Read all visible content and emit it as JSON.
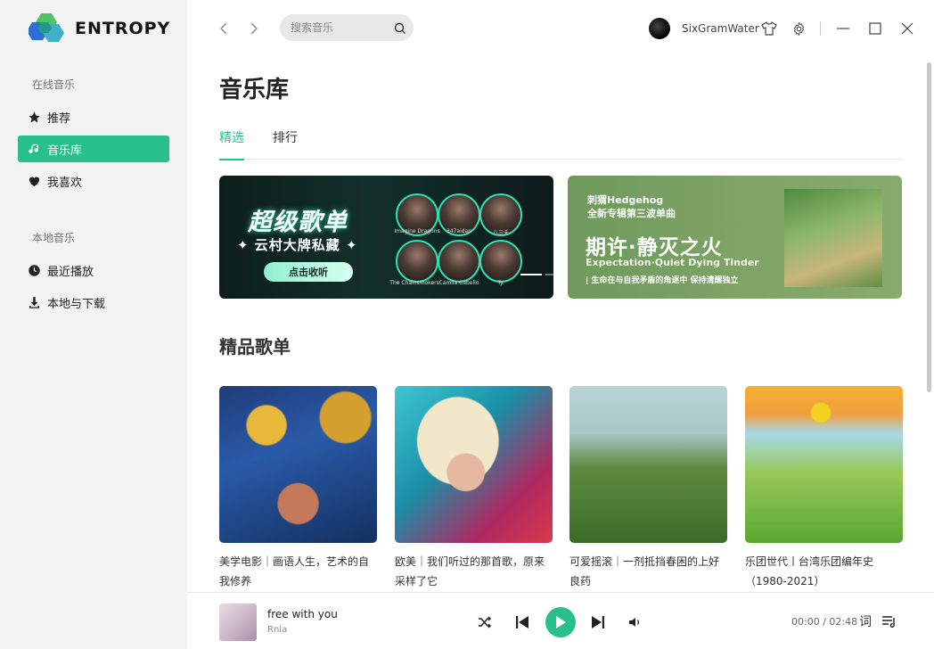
{
  "app": {
    "logo_text": "ENTROPY"
  },
  "sidebar": {
    "online_title": "在线音乐",
    "local_title": "本地音乐",
    "items": [
      {
        "label": "推荐",
        "icon": "star-icon",
        "active": false
      },
      {
        "label": "音乐库",
        "icon": "music-note-icon",
        "active": true
      },
      {
        "label": "我喜欢",
        "icon": "heart-icon",
        "active": false
      },
      {
        "label": "最近播放",
        "icon": "clock-icon",
        "active": false
      },
      {
        "label": "本地与下载",
        "icon": "download-icon",
        "active": false
      }
    ]
  },
  "topbar": {
    "search_placeholder": "搜索音乐",
    "username": "SixGramWater"
  },
  "main": {
    "title": "音乐库",
    "tabs": [
      {
        "label": "精选",
        "active": true
      },
      {
        "label": "排行",
        "active": false
      }
    ],
    "banner1": {
      "title": "超级歌单",
      "subtitle": "✦ 云村大牌私藏 ✦",
      "button": "点击收听",
      "artists": [
        "Imagine Dragons",
        "347aidan",
        "八三夭",
        "The Chainsmokers",
        "Camila Cabello",
        "Ty."
      ]
    },
    "banner2": {
      "line1": "刺猬Hedgehog",
      "line2": "全新专辑第三波单曲",
      "title": "期许·静灭之火",
      "en": "Expectation·Quiet Dying Tinder",
      "small": "| 生命在与自我矛盾的角逐中 保持清醒独立"
    },
    "section_heading": "精品歌单",
    "playlists": [
      {
        "title": "美学电影｜画语人生，艺术的自我修养"
      },
      {
        "title": "欧美｜我们听过的那首歌，原来采样了它"
      },
      {
        "title": "可爱摇滚｜一剂抵挡春困的上好良药"
      },
      {
        "title": "乐团世代丨台湾乐团编年史（1980-2021）"
      }
    ]
  },
  "player": {
    "title": "free with you",
    "artist": "Rnla",
    "time": "00:00 / 02:48",
    "lyric_label": "词"
  },
  "colors": {
    "accent": "#27c08a"
  }
}
